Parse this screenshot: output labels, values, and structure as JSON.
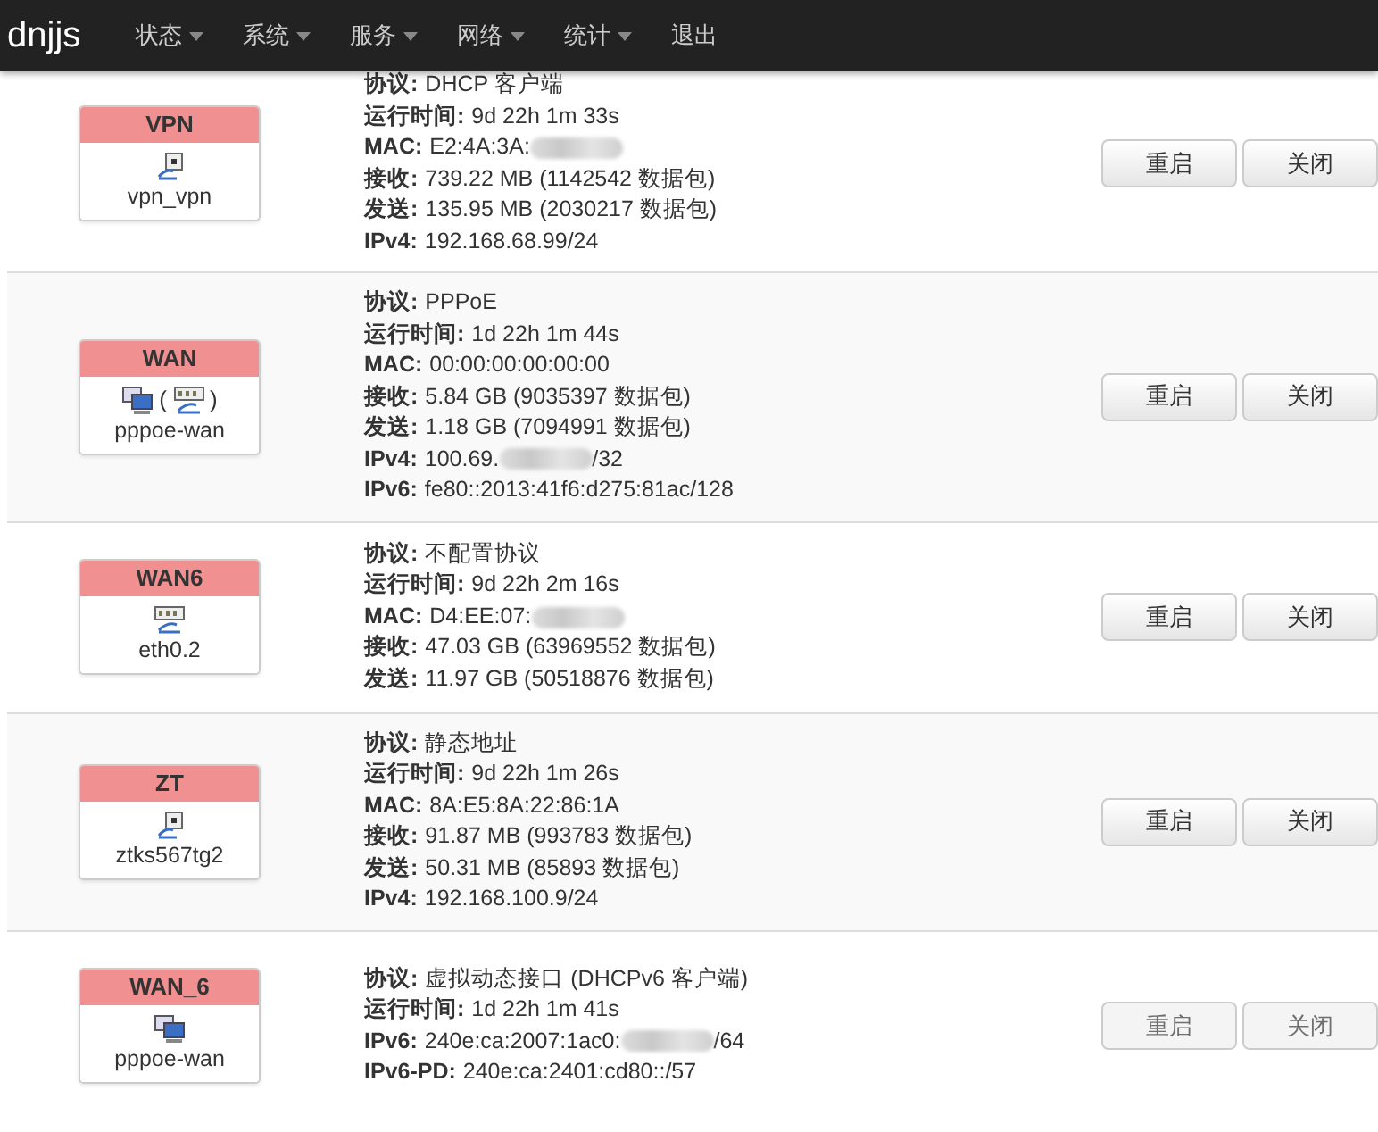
{
  "navbar": {
    "brand": "dnjjs",
    "menus": [
      {
        "label": "状态",
        "dropdown": true
      },
      {
        "label": "系统",
        "dropdown": true
      },
      {
        "label": "服务",
        "dropdown": true
      },
      {
        "label": "网络",
        "dropdown": true
      },
      {
        "label": "统计",
        "dropdown": true
      },
      {
        "label": "退出",
        "dropdown": false
      }
    ]
  },
  "interfaces": [
    {
      "name": "VPN",
      "device": "vpn_vpn",
      "icons": [
        {
          "kind": "tunnel"
        }
      ],
      "details": [
        {
          "label": "协议:",
          "value": "DHCP 客户端"
        },
        {
          "label": "运行时间:",
          "value": "9d 22h 1m 33s"
        },
        {
          "label": "MAC:",
          "value": "E2:4A:3A:",
          "redacted": true
        },
        {
          "label": "接收:",
          "value": "739.22 MB (1142542 数据包)"
        },
        {
          "label": "发送:",
          "value": "135.95 MB (2030217 数据包)"
        },
        {
          "label": "IPv4:",
          "value": "192.168.68.99/24"
        }
      ],
      "buttons": [
        {
          "label": "重启",
          "disabled": false
        },
        {
          "label": "关闭",
          "disabled": false
        }
      ]
    },
    {
      "name": "WAN",
      "device": "pppoe-wan",
      "icons": [
        {
          "kind": "computers"
        },
        {
          "kind": "port",
          "prefix": "(",
          "suffix": ")"
        }
      ],
      "details": [
        {
          "label": "协议:",
          "value": "PPPoE"
        },
        {
          "label": "运行时间:",
          "value": "1d 22h 1m 44s"
        },
        {
          "label": "MAC:",
          "value": "00:00:00:00:00:00"
        },
        {
          "label": "接收:",
          "value": "5.84 GB (9035397 数据包)"
        },
        {
          "label": "发送:",
          "value": "1.18 GB (7094991 数据包)"
        },
        {
          "label": "IPv4:",
          "value": "100.69.",
          "redacted": true,
          "value_end": "/32"
        },
        {
          "label": "IPv6:",
          "value": "fe80::2013:41f6:d275:81ac/128"
        }
      ],
      "buttons": [
        {
          "label": "重启",
          "disabled": false
        },
        {
          "label": "关闭",
          "disabled": false
        }
      ]
    },
    {
      "name": "WAN6",
      "device": "eth0.2",
      "icons": [
        {
          "kind": "port"
        }
      ],
      "details": [
        {
          "label": "协议:",
          "value": "不配置协议"
        },
        {
          "label": "运行时间:",
          "value": "9d 22h 2m 16s"
        },
        {
          "label": "MAC:",
          "value": "D4:EE:07:",
          "redacted": true
        },
        {
          "label": "接收:",
          "value": "47.03 GB (63969552 数据包)"
        },
        {
          "label": "发送:",
          "value": "11.97 GB (50518876 数据包)"
        }
      ],
      "buttons": [
        {
          "label": "重启",
          "disabled": false
        },
        {
          "label": "关闭",
          "disabled": false
        }
      ]
    },
    {
      "name": "ZT",
      "device": "ztks567tg2",
      "icons": [
        {
          "kind": "tunnel"
        }
      ],
      "details": [
        {
          "label": "协议:",
          "value": "静态地址"
        },
        {
          "label": "运行时间:",
          "value": "9d 22h 1m 26s"
        },
        {
          "label": "MAC:",
          "value": "8A:E5:8A:22:86:1A"
        },
        {
          "label": "接收:",
          "value": "91.87 MB (993783 数据包)"
        },
        {
          "label": "发送:",
          "value": "50.31 MB (85893 数据包)"
        },
        {
          "label": "IPv4:",
          "value": "192.168.100.9/24"
        }
      ],
      "buttons": [
        {
          "label": "重启",
          "disabled": false
        },
        {
          "label": "关闭",
          "disabled": false
        }
      ]
    },
    {
      "name": "WAN_6",
      "device": "pppoe-wan",
      "icons": [
        {
          "kind": "computers"
        }
      ],
      "details": [
        {
          "label": "协议:",
          "value": "虚拟动态接口 (DHCPv6 客户端)"
        },
        {
          "label": "运行时间:",
          "value": "1d 22h 1m 41s"
        },
        {
          "label": "IPv6:",
          "value": "240e:ca:2007:1ac0:",
          "redacted": true,
          "value_end": "/64"
        },
        {
          "label": "IPv6-PD:",
          "value": "240e:ca:2401:cd80::/57"
        }
      ],
      "buttons": [
        {
          "label": "重启",
          "disabled": true
        },
        {
          "label": "关闭",
          "disabled": true
        }
      ]
    }
  ]
}
